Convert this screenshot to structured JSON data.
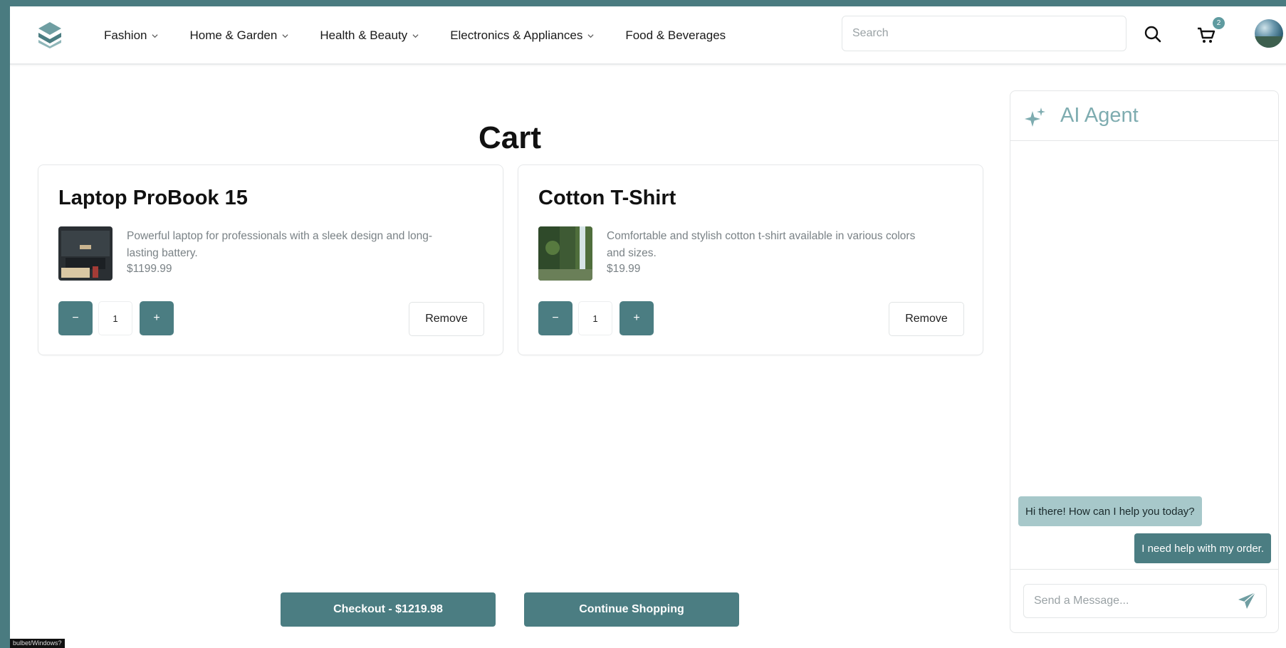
{
  "header": {
    "nav": [
      {
        "label": "Fashion",
        "has_dropdown": true
      },
      {
        "label": "Home & Garden",
        "has_dropdown": true
      },
      {
        "label": "Health & Beauty",
        "has_dropdown": true
      },
      {
        "label": "Electronics & Appliances",
        "has_dropdown": true
      },
      {
        "label": "Food & Beverages",
        "has_dropdown": false
      }
    ],
    "search_placeholder": "Search",
    "cart_count": "2"
  },
  "main": {
    "title": "Cart",
    "items": [
      {
        "name": "Laptop ProBook 15",
        "description": "Powerful laptop for professionals with a sleek design and long-lasting battery.",
        "price": "$1199.99",
        "quantity": "1",
        "minus_label": "−",
        "plus_label": "+",
        "remove_label": "Remove"
      },
      {
        "name": "Cotton T-Shirt",
        "description": "Comfortable and stylish cotton t-shirt available in various colors and sizes.",
        "price": "$19.99",
        "quantity": "1",
        "minus_label": "−",
        "plus_label": "+",
        "remove_label": "Remove"
      }
    ],
    "checkout_label": "Checkout - $1219.98",
    "continue_label": "Continue Shopping"
  },
  "ai_agent": {
    "title": "AI Agent",
    "messages": [
      {
        "from": "agent",
        "text": "Hi there! How can I help you today?"
      },
      {
        "from": "user",
        "text": "I need help with my order."
      }
    ],
    "input_placeholder": "Send a Message..."
  },
  "status_bar": {
    "text": "bulbet/Windows?"
  },
  "colors": {
    "primary": "#4b7d82",
    "frame": "#4a7b80",
    "agent_bubble": "#a7c8ca",
    "accent_text": "#7eacb0"
  },
  "icons": [
    "logo-icon",
    "chevron-down-icon",
    "search-icon",
    "cart-icon",
    "avatar",
    "sparkle-icon",
    "send-icon"
  ]
}
